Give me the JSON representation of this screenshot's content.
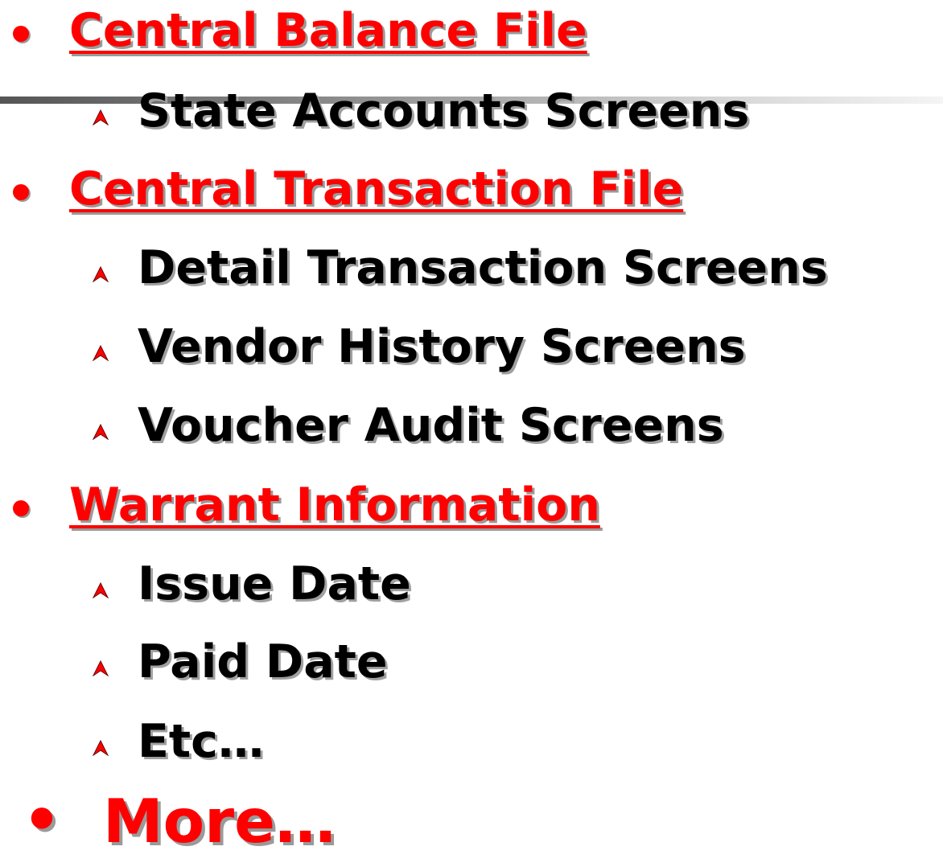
{
  "slide": {
    "items": [
      {
        "level": 1,
        "text": "Central Balance File",
        "link": true
      },
      {
        "level": 2,
        "text": "State Accounts Screens"
      },
      {
        "level": 1,
        "text": "Central Transaction File",
        "link": true
      },
      {
        "level": 2,
        "text": "Detail Transaction Screens"
      },
      {
        "level": 2,
        "text": "Vendor History Screens"
      },
      {
        "level": 2,
        "text": "Voucher Audit Screens"
      },
      {
        "level": 1,
        "text": "Warrant Information",
        "link": true
      },
      {
        "level": 2,
        "text": "Issue Date"
      },
      {
        "level": 2,
        "text": "Paid Date"
      },
      {
        "level": 2,
        "text": "Etc…"
      },
      {
        "level": 0,
        "text": "More…"
      }
    ],
    "bullet_char": "•",
    "colors": {
      "accent": "#ff0000",
      "text": "#000000",
      "shadow": "#9a9a9a"
    }
  }
}
